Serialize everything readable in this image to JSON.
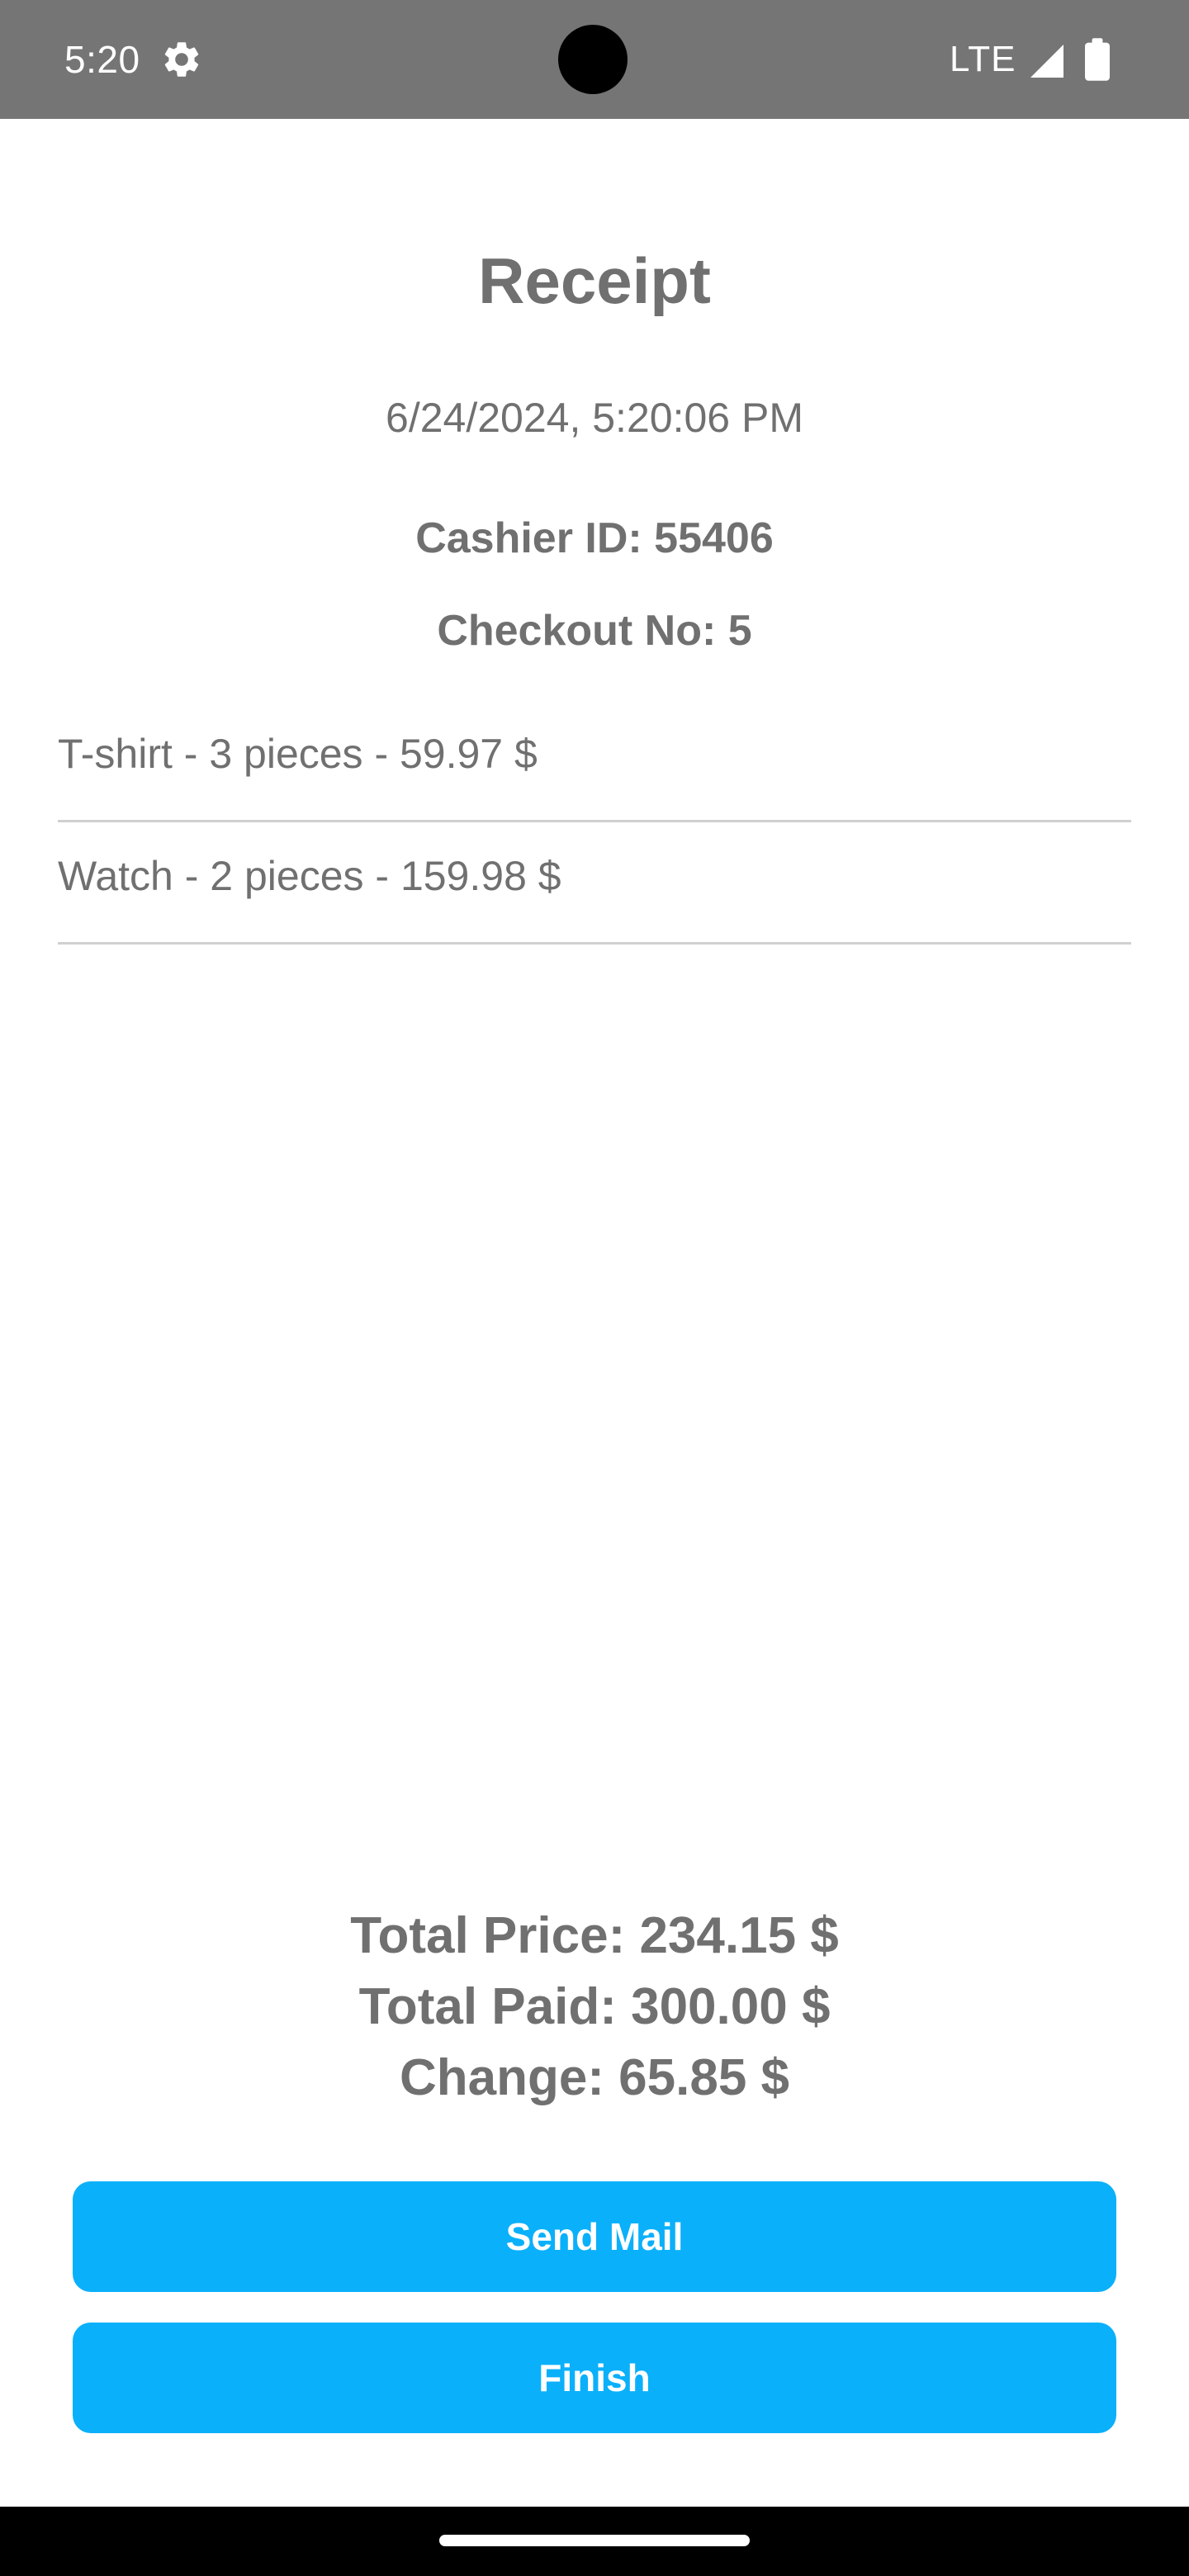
{
  "status_bar": {
    "time": "5:20",
    "network": "LTE",
    "icons": [
      "gear-icon",
      "signal-icon",
      "battery-icon"
    ]
  },
  "receipt": {
    "title": "Receipt",
    "datetime": "6/24/2024, 5:20:06 PM",
    "cashier": "Cashier ID: 55406",
    "checkout": "Checkout No: 5",
    "items": [
      {
        "text": "T-shirt - 3 pieces - 59.97 $"
      },
      {
        "text": "Watch - 2 pieces - 159.98 $"
      }
    ],
    "totals": {
      "total_price": "Total Price: 234.15 $",
      "total_paid": "Total Paid: 300.00 $",
      "change": "Change: 65.85 $"
    }
  },
  "actions": {
    "send_mail_label": "Send Mail",
    "finish_label": "Finish"
  },
  "colors": {
    "status_bar_bg": "#757575",
    "text": "#707070",
    "button_bg": "#0bb0fa",
    "button_text": "#ffffff",
    "divider": "#d0d0d0"
  }
}
